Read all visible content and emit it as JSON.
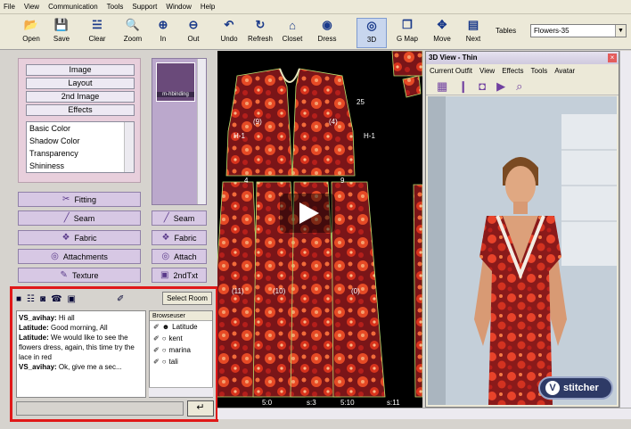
{
  "menubar": [
    "File",
    "View",
    "Communication",
    "Tools",
    "Support",
    "Window",
    "Help"
  ],
  "toolbar": {
    "buttons": [
      {
        "label": "Open",
        "icon": "open-icon"
      },
      {
        "label": "Save",
        "icon": "save-icon"
      },
      {
        "label": "Clear",
        "icon": "clear-icon"
      },
      {
        "label": "Zoom",
        "icon": "zoom-icon"
      },
      {
        "label": "In",
        "icon": "zoom-in-icon"
      },
      {
        "label": "Out",
        "icon": "zoom-out-icon"
      },
      {
        "label": "Undo",
        "icon": "undo-icon"
      },
      {
        "label": "Refresh",
        "icon": "refresh-icon"
      },
      {
        "label": "Closet",
        "icon": "closet-icon"
      },
      {
        "label": "Dress",
        "icon": "dress-icon"
      },
      {
        "label": "3D",
        "icon": "eye-icon"
      },
      {
        "label": "G Map",
        "icon": "gmap-icon"
      },
      {
        "label": "Move",
        "icon": "move-icon"
      },
      {
        "label": "Next",
        "icon": "next-icon"
      }
    ],
    "tables_label": "Tables",
    "tables_value": "Flowers-35"
  },
  "left": {
    "tabs": [
      "Image",
      "Layout",
      "2nd Image",
      "Effects"
    ],
    "effects": [
      "Basic Color",
      "Shadow Color",
      "Transparency",
      "Shininess"
    ],
    "buttons": [
      "Fitting",
      "Seam",
      "Fabric",
      "Attachments",
      "Texture"
    ],
    "narrow_buttons": [
      "Seam",
      "Fabric",
      "Attach",
      "2ndTxt"
    ],
    "swatch_label": "m-hbinding"
  },
  "chat": {
    "select_room": "Select Room",
    "messages": [
      {
        "user": "VS_avihay:",
        "text": " Hi all"
      },
      {
        "user": "Latitude:",
        "text": " Good morning, All"
      },
      {
        "user": "Latitude:",
        "text": " We would like to see the flowers dress, again, this time try the lace in red"
      },
      {
        "user": "VS_avihay:",
        "text": " Ok, give me a sec..."
      }
    ],
    "browse_header": "Browseuser",
    "users": [
      "Latitude",
      "kent",
      "marina",
      "tali"
    ]
  },
  "view3d": {
    "title": "3D View - Thin",
    "menu": [
      "Current Outfit",
      "View",
      "Effects",
      "Tools",
      "Avatar"
    ],
    "logo": "stitcher"
  },
  "pattern": {
    "labels": [
      "(9)",
      "(4)",
      "H-1",
      "H-1",
      "(11)",
      "(10)",
      "(0)",
      "25",
      "9",
      "4",
      "5:0",
      "s:3",
      "5:10",
      "s:11"
    ]
  }
}
